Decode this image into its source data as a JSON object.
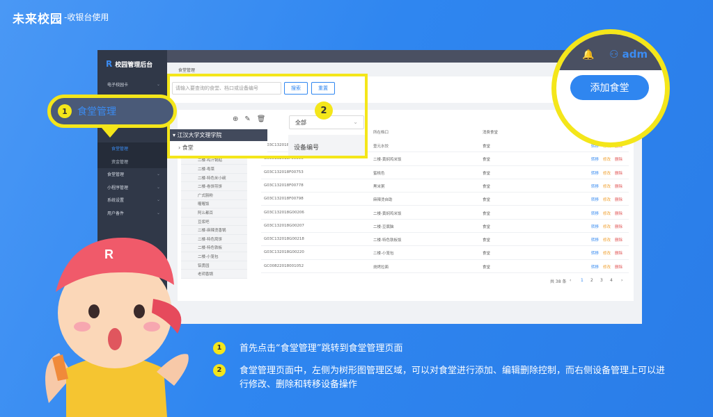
{
  "brand": {
    "name": "未来校园",
    "subtitle": "-收银台使用"
  },
  "sidebar": {
    "logo": "校园管理后台",
    "items": [
      {
        "label": "电子校园卡",
        "chev": "⌄"
      },
      {
        "label": "食堂管理",
        "active": true
      },
      {
        "label": "资金管理"
      },
      {
        "label": "食堂管理",
        "chev": "⌄"
      },
      {
        "label": "小程序管理",
        "chev": "⌄"
      },
      {
        "label": "系统设置",
        "chev": "⌄"
      },
      {
        "label": "用户备件",
        "chev": "⌄"
      }
    ]
  },
  "breadcrumb": "食堂管理",
  "search": {
    "placeholder": "请输入要查询的食堂、档口或设备编号",
    "search_label": "搜索",
    "reset_label": "重置"
  },
  "tree": {
    "root": "江汉大学文理学院",
    "child": "食堂",
    "items": [
      "二楼-黄焖鸡米饭",
      "二楼-鸡汁锅贴",
      "二楼-粤菜",
      "二楼-特色米小碗",
      "二楼-卷饼煎饼",
      "广式肠粉",
      "喔喔饭",
      "阿么都百",
      "豆浆吧",
      "二楼-麻辣烫香锅",
      "二楼-特色窝饼",
      "二楼-特色铁板",
      "二楼-小笼包",
      "铝勇园",
      "老玥香锅"
    ]
  },
  "table": {
    "select_value": "全部",
    "headers": [
      "设备编号",
      "所在档口",
      "消费食堂"
    ],
    "rows": [
      [
        "G03C132018F00095",
        "壹元水饺",
        "食堂"
      ],
      [
        "G03C132018F00096",
        "二楼-黄焖鸡米饭",
        "食堂"
      ],
      [
        "G03C132018F00753",
        "蜜桃色",
        "食堂"
      ],
      [
        "G03C132018F00778",
        "黑米粥",
        "食堂"
      ],
      [
        "G03C132018F00798",
        "麻辣烫自助",
        "食堂"
      ],
      [
        "G03C132018G00206",
        "二楼-黄焖鸡米饭",
        "食堂"
      ],
      [
        "G03C132018G00207",
        "二楼-豆腐脑",
        "食堂"
      ],
      [
        "G03C132018G00218",
        "二楼-特色铁板饭",
        "食堂"
      ],
      [
        "G03C132018G00220",
        "二楼-小笼包",
        "食堂"
      ],
      [
        "GC00822018001052",
        "烧烤拉面",
        "食堂"
      ]
    ],
    "actions": {
      "move": "转移",
      "edit": "修改",
      "delete": "删除"
    },
    "pager": {
      "total": "共 38 条",
      "prev": "‹",
      "pages": [
        "1",
        "2",
        "3",
        "4"
      ],
      "next": "›"
    }
  },
  "callout1": {
    "badge": "1",
    "label": "食堂管理"
  },
  "callout2": {
    "badge": "2",
    "column": "设备编号"
  },
  "circle": {
    "bell_icon": "bell-icon",
    "user": "adm",
    "add_button": "添加食堂"
  },
  "steps": [
    {
      "badge": "1",
      "text": "首先点击“食堂管理”跳转到食堂管理页面"
    },
    {
      "badge": "2",
      "text": "食堂管理页面中，左侧为树形图管理区域，可以对食堂进行添加、编辑删除控制，而右侧设备管理上可以进行修改、删除和转移设备操作"
    }
  ],
  "colors": {
    "background": "#2f86f0",
    "highlight": "#f4e61a",
    "accent": "#3b8cf3"
  }
}
